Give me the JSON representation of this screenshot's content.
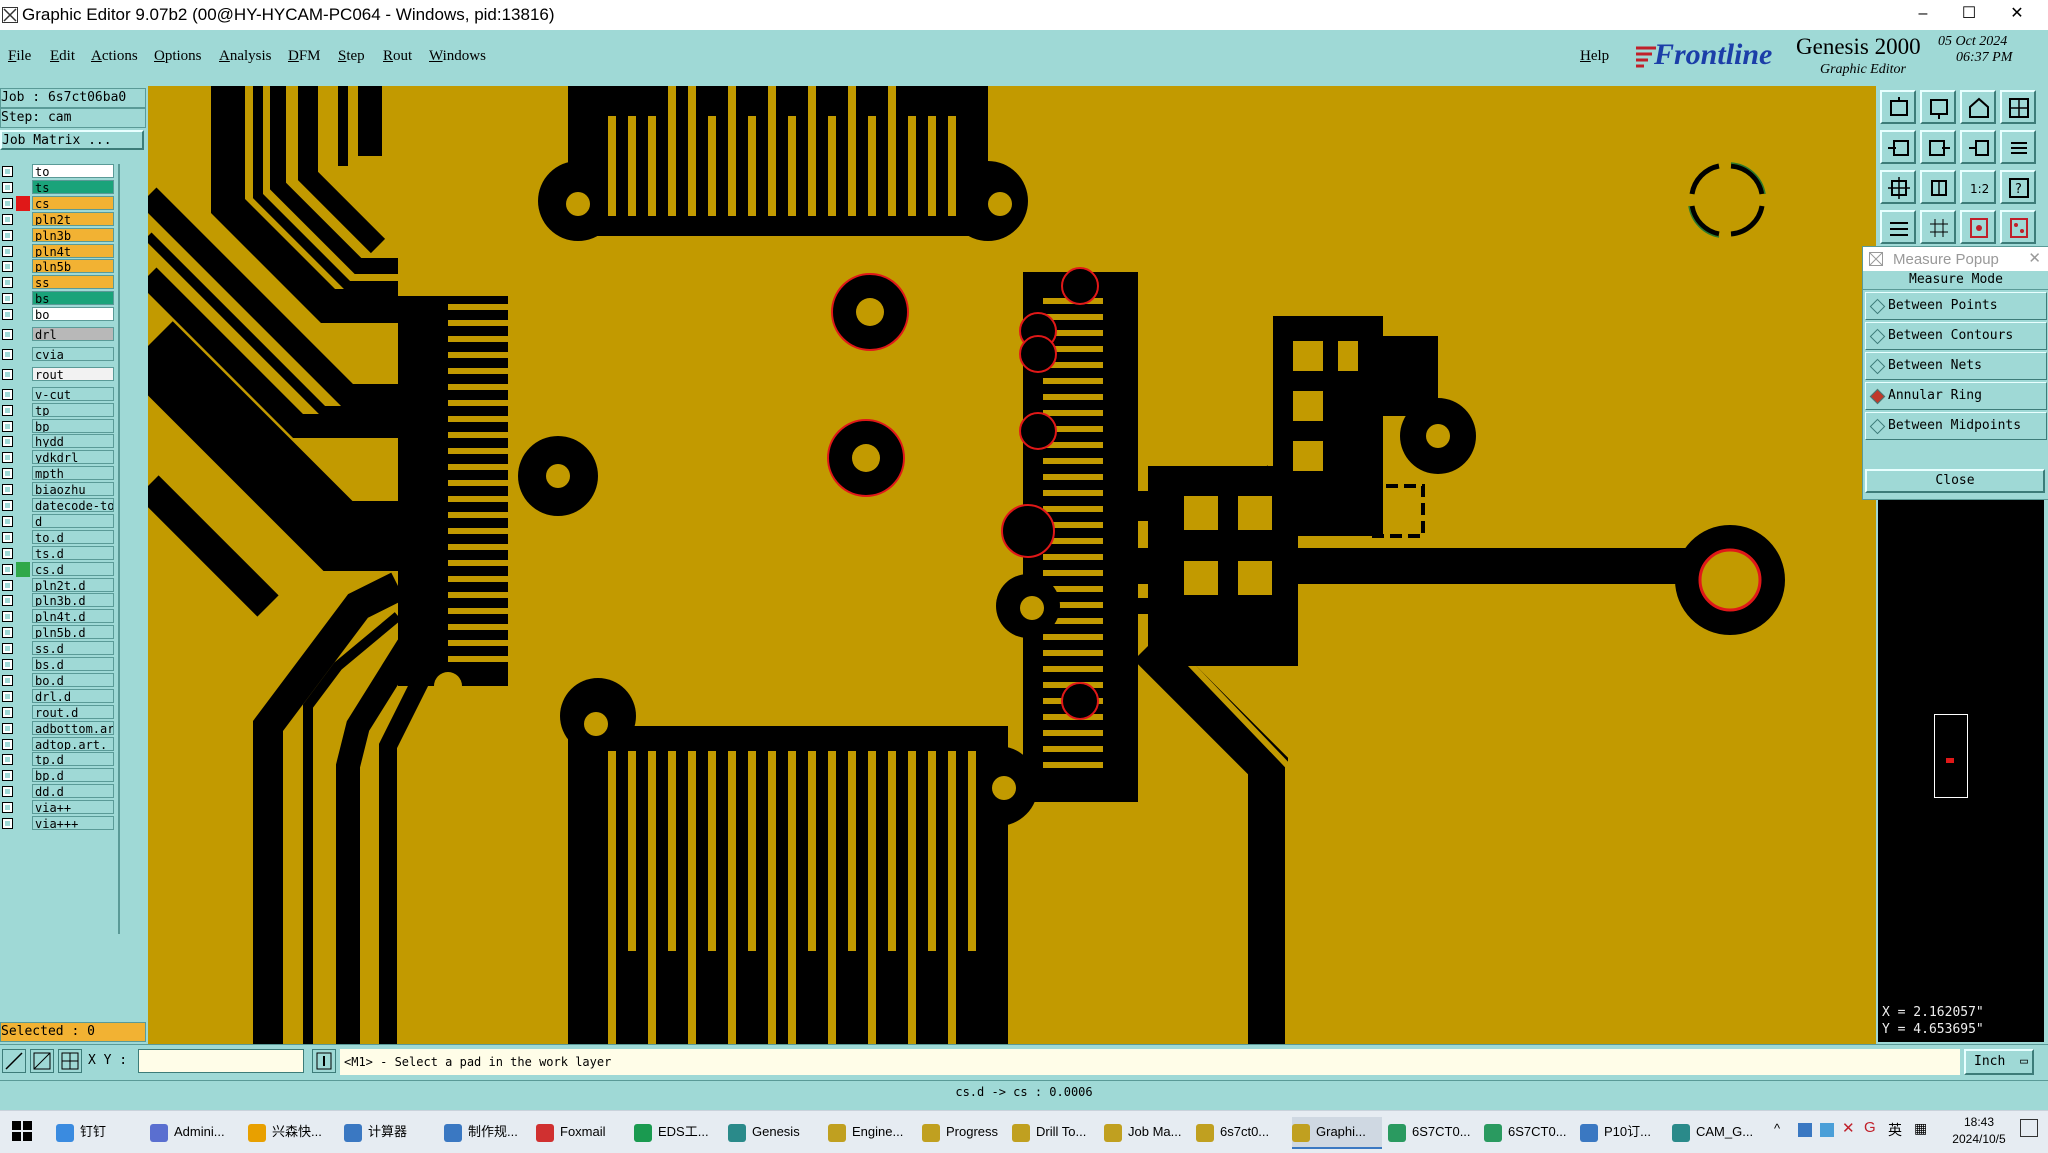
{
  "window": {
    "title": "Graphic Editor 9.07b2 (00@HY-HYCAM-PC064 - Windows, pid:13816)",
    "minimize": "–",
    "maximize": "☐",
    "close": "✕"
  },
  "menu": [
    "File",
    "Edit",
    "Actions",
    "Options",
    "Analysis",
    "DFM",
    "Step",
    "Rout",
    "Windows"
  ],
  "help_label": "Help",
  "brand": {
    "logo": "Frontline",
    "product": "Genesis 2000",
    "subtitle": "Graphic Editor",
    "date": "05 Oct 2024",
    "time": "06:37 PM"
  },
  "job": {
    "job_line": "Job : 6s7ct06ba0",
    "step_line": "Step: cam",
    "matrix_button": "Job Matrix ..."
  },
  "layers": [
    {
      "name": "to",
      "color": "#ffffff"
    },
    {
      "name": "ts",
      "color": "#1aa37a"
    },
    {
      "name": "cs",
      "color": "#f2b233",
      "active": true
    },
    {
      "name": "pln2t",
      "color": "#f2b233"
    },
    {
      "name": "pln3b",
      "color": "#f2b233"
    },
    {
      "name": "pln4t",
      "color": "#f2b233"
    },
    {
      "name": "pln5b",
      "color": "#f2b233"
    },
    {
      "name": "ss",
      "color": "#f2b233"
    },
    {
      "name": "bs",
      "color": "#1aa37a"
    },
    {
      "name": "bo",
      "color": "#ffffff"
    },
    {
      "name": "drl",
      "color": "#b8b8b8"
    },
    {
      "name": "cvia",
      "color": "#9fd9d6"
    },
    {
      "name": "rout",
      "color": "#f2f2f2"
    },
    {
      "name": "v-cut",
      "color": "#9fd9d6"
    },
    {
      "name": "tp",
      "color": "#9fd9d6"
    },
    {
      "name": "bp",
      "color": "#9fd9d6"
    },
    {
      "name": "hydd",
      "color": "#9fd9d6"
    },
    {
      "name": "ydkdrl",
      "color": "#9fd9d6"
    },
    {
      "name": "mpth",
      "color": "#9fd9d6"
    },
    {
      "name": "biaozhu",
      "color": "#9fd9d6"
    },
    {
      "name": "datecode-to",
      "color": "#9fd9d6"
    },
    {
      "name": "d",
      "color": "#9fd9d6"
    },
    {
      "name": "to.d",
      "color": "#9fd9d6"
    },
    {
      "name": "ts.d",
      "color": "#9fd9d6"
    },
    {
      "name": "cs.d",
      "color": "#9fd9d6",
      "marker": "#2fa84a"
    },
    {
      "name": "pln2t.d",
      "color": "#9fd9d6"
    },
    {
      "name": "pln3b.d",
      "color": "#9fd9d6"
    },
    {
      "name": "pln4t.d",
      "color": "#9fd9d6"
    },
    {
      "name": "pln5b.d",
      "color": "#9fd9d6"
    },
    {
      "name": "ss.d",
      "color": "#9fd9d6"
    },
    {
      "name": "bs.d",
      "color": "#9fd9d6"
    },
    {
      "name": "bo.d",
      "color": "#9fd9d6"
    },
    {
      "name": "drl.d",
      "color": "#9fd9d6"
    },
    {
      "name": "rout.d",
      "color": "#9fd9d6"
    },
    {
      "name": "adbottom.art",
      "color": "#9fd9d6"
    },
    {
      "name": "adtop.art.",
      "color": "#9fd9d6"
    },
    {
      "name": "tp.d",
      "color": "#9fd9d6"
    },
    {
      "name": "bp.d",
      "color": "#9fd9d6"
    },
    {
      "name": "dd.d",
      "color": "#9fd9d6"
    },
    {
      "name": "via++",
      "color": "#9fd9d6"
    },
    {
      "name": "via+++",
      "color": "#9fd9d6"
    }
  ],
  "selected_label": "Selected : 0",
  "measure": {
    "title": "Measure Popup",
    "mode_label": "Measure Mode",
    "options": [
      "Between Points",
      "Between Contours",
      "Between Nets",
      "Annular Ring",
      "Between Midpoints"
    ],
    "selected": "Annular Ring",
    "close_label": "Close"
  },
  "coords": {
    "x": "X = 2.162057\"",
    "y": "Y = 4.653695\""
  },
  "status": {
    "xy_label": "X Y :",
    "xy_value": "",
    "prompt": "<M1> - Select a pad in the work layer",
    "units": "Inch"
  },
  "message": "cs.d -> cs : 0.0006",
  "colors": {
    "board": "#c29a00",
    "copper_void": "#000000",
    "highlight": "#e01818",
    "panel": "#9fd9d6"
  },
  "taskbar": {
    "items": [
      "钉钉",
      "Admini...",
      "兴森快...",
      "计算器",
      "制作规...",
      "Foxmail",
      "EDS工...",
      "Genesis",
      "Engine...",
      "Progress",
      "Drill To...",
      "Job Ma...",
      "6s7ct0...",
      "Graphi...",
      "6S7CT0...",
      "6S7CT0...",
      "P10订...",
      "CAM_G..."
    ],
    "active": "Graphi...",
    "tray_lang": "英",
    "clock_time": "18:43",
    "clock_date": "2024/10/5"
  }
}
